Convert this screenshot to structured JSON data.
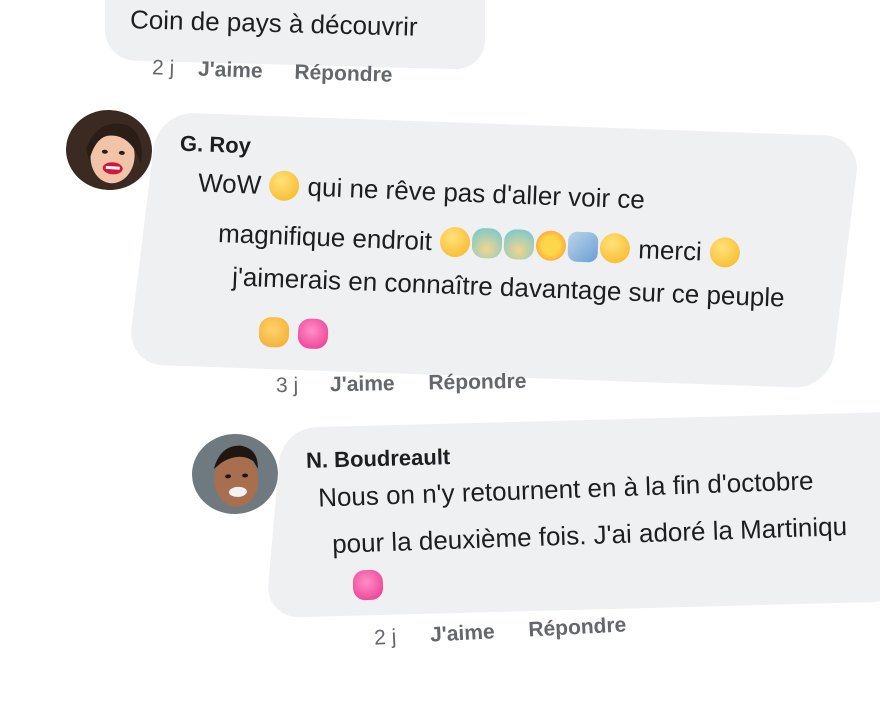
{
  "comments": [
    {
      "author": "",
      "lines": [
        "Coin de pays à découvrir"
      ],
      "time": "2 j",
      "like_label": "J'aime",
      "reply_label": "Répondre"
    },
    {
      "author": "G. Roy",
      "line1_a": "WoW",
      "line1_b": "qui ne rêve pas d'aller voir ce",
      "line2_a": "magnifique endroit",
      "line2_b": "merci",
      "line3": "j'aimerais en connaître davantage sur ce peuple",
      "time": "3 j",
      "like_label": "J'aime",
      "reply_label": "Répondre"
    },
    {
      "author": "N. Boudreault",
      "line1": "Nous on n'y retournent en à la fin d'octobre",
      "line2": "pour la deuxième fois. J'ai adoré la Martiniqu",
      "time": "2 j",
      "like_label": "J'aime",
      "reply_label": "Répondre"
    }
  ],
  "colors": {
    "bubble": "#eff0f2",
    "text": "#1c1e21",
    "meta": "#65676b"
  },
  "icons": [
    "avatar-g-roy",
    "avatar-n-boudreault",
    "emoji-surprised",
    "emoji-hug",
    "emoji-island",
    "emoji-umbrella",
    "emoji-sun",
    "emoji-plane",
    "emoji-heart-eyes",
    "emoji-smile",
    "emoji-crossed-fingers",
    "emoji-hearts-face",
    "emoji-two-hearts"
  ]
}
